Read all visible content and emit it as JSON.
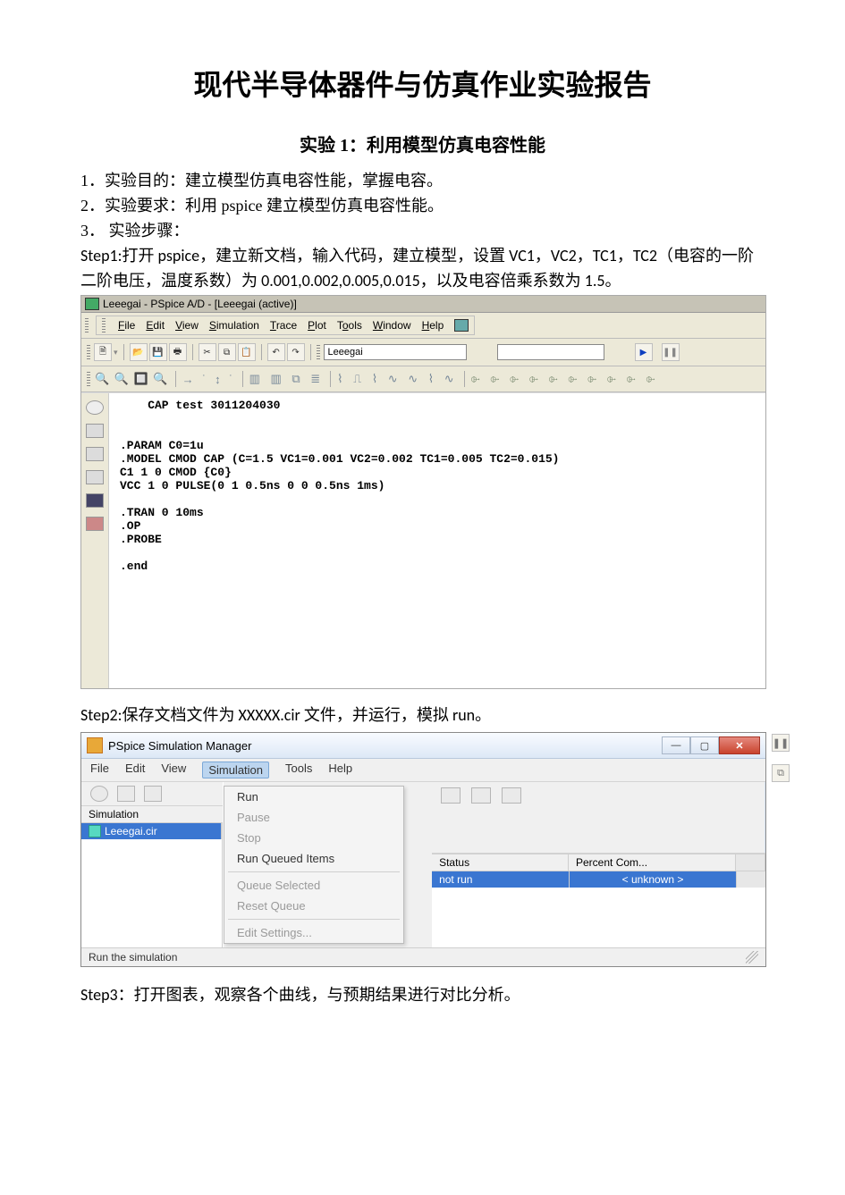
{
  "doc": {
    "title": "现代半导体器件与仿真作业实验报告",
    "subtitle": "实验 1：利用模型仿真电容性能",
    "p1": "1．实验目的：建立模型仿真电容性能，掌握电容。",
    "p2": "2．实验要求：利用 pspice 建立模型仿真电容性能。",
    "p3": "3．  实验步骤：",
    "step1": "Step1:打开 pspice，建立新文档，输入代码，建立模型，设置 VC1，VC2，TC1，TC2（电容的一阶二阶电压，温度系数）为 0.001,0.002,0.005,0.015，以及电容倍乘系数为 1.5。",
    "step2": "Step2:保存文档文件为 XXXXX.cir 文件，并运行，模拟 run。",
    "step3": "Step3：打开图表，观察各个曲线，与预期结果进行对比分析。"
  },
  "pspice": {
    "title": "Leeegai - PSpice A/D  - [Leeegai (active)]",
    "menu": {
      "file": "File",
      "edit": "Edit",
      "view": "View",
      "simulation": "Simulation",
      "trace": "Trace",
      "plot": "Plot",
      "tools": "Tools",
      "window": "Window",
      "help": "Help"
    },
    "combo_value": "Leeegai",
    "code": "    CAP test 3011204030\n\n\n.PARAM C0=1u\n.MODEL CMOD CAP (C=1.5 VC1=0.001 VC2=0.002 TC1=0.005 TC2=0.015)\nC1 1 0 CMOD {C0}\nVCC 1 0 PULSE(0 1 0.5ns 0 0 0.5ns 1ms)\n\n.TRAN 0 10ms\n.OP\n.PROBE\n\n.end"
  },
  "simmgr": {
    "title": "PSpice Simulation Manager",
    "menu": {
      "file": "File",
      "edit": "Edit",
      "view": "View",
      "simulation": "Simulation",
      "tools": "Tools",
      "help": "Help"
    },
    "dropdown": {
      "run": "Run",
      "pause": "Pause",
      "stop": "Stop",
      "run_queued": "Run Queued Items",
      "queue_selected": "Queue Selected",
      "reset_queue": "Reset Queue",
      "edit_settings": "Edit Settings..."
    },
    "columns": {
      "simulation": "Simulation",
      "status": "Status",
      "percent": "Percent Com..."
    },
    "row": {
      "file": "Leeegai.cir",
      "status": "not run",
      "percent": "< unknown >"
    },
    "statusbar": "Run the simulation"
  }
}
